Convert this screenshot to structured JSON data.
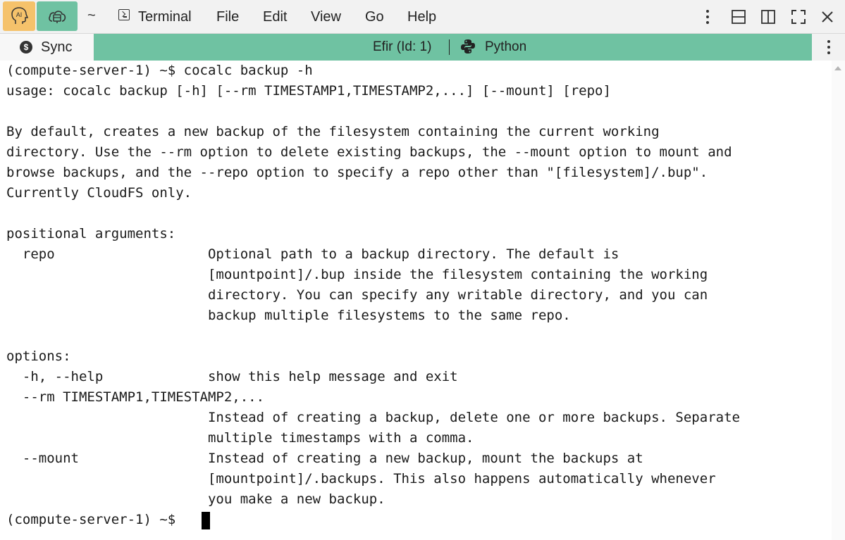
{
  "toolbar": {
    "ai_label": "AI",
    "path_label": "~",
    "menu": [
      "Terminal",
      "File",
      "Edit",
      "View",
      "Go",
      "Help"
    ],
    "icons": [
      "kebab-icon",
      "split-horizontal-icon",
      "split-vertical-icon",
      "fullscreen-icon",
      "close-icon"
    ]
  },
  "subbar": {
    "sync_label": "Sync",
    "kernel": "Efir (Id: 1)",
    "language": "Python"
  },
  "colors": {
    "ai_button": "#f5c26b",
    "accent_green": "#6fc2a2",
    "toolbar_bg": "#f2f2f2"
  },
  "terminal": {
    "lines": [
      "(compute-server-1) ~$ cocalc backup -h",
      "usage: cocalc backup [-h] [--rm TIMESTAMP1,TIMESTAMP2,...] [--mount] [repo]",
      "",
      "By default, creates a new backup of the filesystem containing the current working",
      "directory. Use the --rm option to delete existing backups, the --mount option to mount and",
      "browse backups, and the --repo option to specify a repo other than \"[filesystem]/.bup\".",
      "Currently CloudFS only.",
      "",
      "positional arguments:",
      "  repo                   Optional path to a backup directory. The default is",
      "                         [mountpoint]/.bup inside the filesystem containing the working",
      "                         directory. You can specify any writable directory, and you can",
      "                         backup multiple filesystems to the same repo.",
      "",
      "options:",
      "  -h, --help             show this help message and exit",
      "  --rm TIMESTAMP1,TIMESTAMP2,...",
      "                         Instead of creating a backup, delete one or more backups. Separate",
      "                         multiple timestamps with a comma.",
      "  --mount                Instead of creating a new backup, mount the backups at",
      "                         [mountpoint]/.backups. This also happens automatically whenever",
      "                         you make a new backup.",
      "(compute-server-1) ~$ "
    ]
  }
}
